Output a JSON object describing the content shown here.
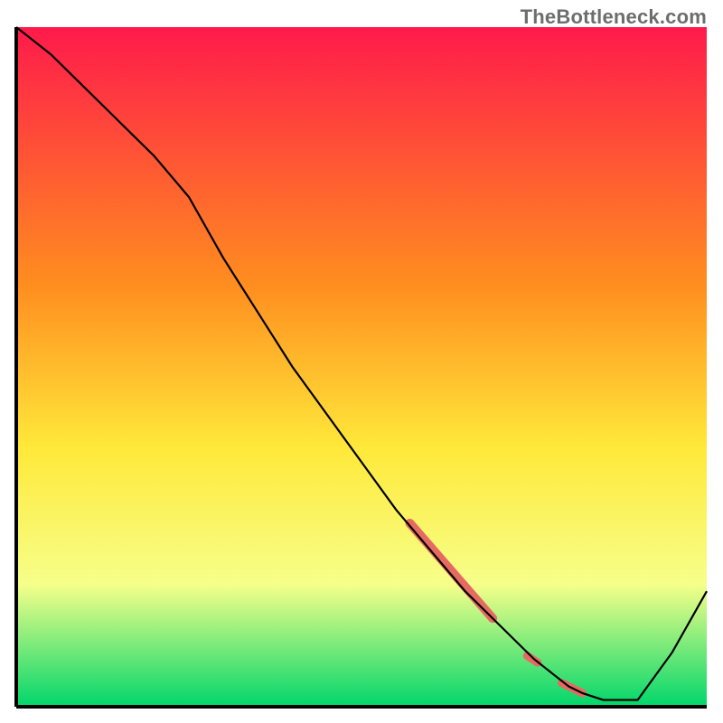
{
  "watermark": "TheBottleneck.com",
  "colors": {
    "axis": "#000000",
    "curve": "#000000",
    "highlight": "#e66a62",
    "grad_top": "#ff1a4b",
    "grad_mid1": "#ff8e1f",
    "grad_mid2": "#ffe93a",
    "grad_mid3": "#f6ff8a",
    "grad_bottom": "#00d66b"
  },
  "chart_data": {
    "type": "line",
    "title": "",
    "xlabel": "",
    "ylabel": "",
    "xlim": [
      0,
      100
    ],
    "ylim": [
      0,
      100
    ],
    "x": [
      0,
      5,
      10,
      15,
      20,
      25,
      30,
      35,
      40,
      45,
      50,
      55,
      60,
      65,
      70,
      75,
      80,
      82,
      85,
      90,
      95,
      100
    ],
    "values": [
      100,
      96,
      91,
      86,
      81,
      75,
      66,
      58,
      50,
      43,
      36,
      29,
      23,
      17,
      12,
      7,
      3,
      2,
      1,
      1,
      8,
      17
    ],
    "highlight_segments": [
      {
        "x0": 57,
        "y0": 27,
        "x1": 69,
        "y1": 13,
        "width": 10
      },
      {
        "x0": 74,
        "y0": 7.5,
        "x1": 75.5,
        "y1": 6.5,
        "width": 9
      },
      {
        "x0": 79,
        "y0": 3.5,
        "x1": 82,
        "y1": 2,
        "width": 9
      }
    ],
    "gradient_stops": [
      {
        "offset": 0.0,
        "key": "grad_top"
      },
      {
        "offset": 0.38,
        "key": "grad_mid1"
      },
      {
        "offset": 0.62,
        "key": "grad_mid2"
      },
      {
        "offset": 0.82,
        "key": "grad_mid3"
      },
      {
        "offset": 1.0,
        "key": "grad_bottom"
      }
    ]
  },
  "layout": {
    "margin_left": 18,
    "margin_right": 18,
    "margin_top": 30,
    "margin_bottom": 18,
    "axis_width": 4,
    "curve_width": 2.2
  }
}
